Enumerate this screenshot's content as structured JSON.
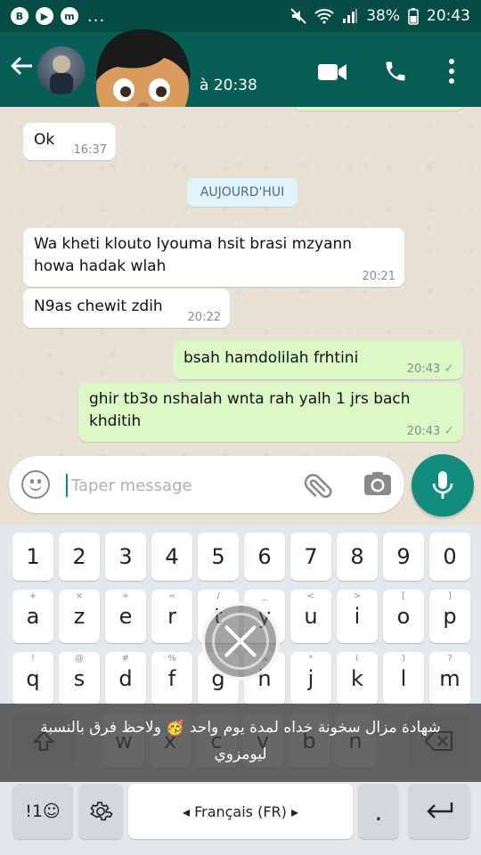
{
  "status_bar": {
    "left_icons": [
      "B",
      "▶",
      "m"
    ],
    "dots": "...",
    "signal_icon": "signal-icon",
    "battery_percent": "38%",
    "time": "20:43"
  },
  "header": {
    "last_seen": "à 20:38"
  },
  "chat": {
    "date_divider": "AUJOURD'HUI",
    "messages": [
      {
        "dir": "in",
        "text": "Ok",
        "time": "16:37"
      },
      {
        "dir": "in",
        "text": "Wa kheti klouto lyouma hsit brasi mzyann howa hadak wlah",
        "time": "20:21"
      },
      {
        "dir": "in",
        "text": "N9as chewit zdih",
        "time": "20:22"
      },
      {
        "dir": "out",
        "text": "bsah  hamdolilah frhtini",
        "time": "20:43"
      },
      {
        "dir": "out",
        "text": "ghir tb3o nshalah wnta rah yalh 1 jrs bach khditih",
        "time": "20:43"
      }
    ]
  },
  "composer": {
    "placeholder": "Taper message"
  },
  "keyboard": {
    "number_row": [
      "1",
      "2",
      "3",
      "4",
      "5",
      "6",
      "7",
      "8",
      "9",
      "0"
    ],
    "row1": [
      {
        "label": "a",
        "hint": "+"
      },
      {
        "label": "z",
        "hint": "×"
      },
      {
        "label": "e",
        "hint": "÷"
      },
      {
        "label": "r",
        "hint": "="
      },
      {
        "label": "t",
        "hint": "/"
      },
      {
        "label": "y",
        "hint": "_"
      },
      {
        "label": "u",
        "hint": "<"
      },
      {
        "label": "i",
        "hint": ">"
      },
      {
        "label": "o",
        "hint": "["
      },
      {
        "label": "p",
        "hint": "]"
      }
    ],
    "row2": [
      {
        "label": "q",
        "hint": "!"
      },
      {
        "label": "s",
        "hint": "@"
      },
      {
        "label": "d",
        "hint": "#"
      },
      {
        "label": "f",
        "hint": "%"
      },
      {
        "label": "g",
        "hint": "^"
      },
      {
        "label": "h",
        "hint": "&"
      },
      {
        "label": "j",
        "hint": "*"
      },
      {
        "label": "k",
        "hint": "("
      },
      {
        "label": "l",
        "hint": ")"
      },
      {
        "label": "m",
        "hint": "?"
      }
    ],
    "row3": [
      "w",
      "x",
      "c",
      "v",
      "b",
      "n"
    ],
    "symbols_key": "!1☺",
    "language": "◂  Français (FR)  ▸",
    "period": ".",
    "shift_icon": "shift-icon",
    "backspace_icon": "backspace-icon",
    "settings_icon": "gear-icon",
    "enter_icon": "enter-icon"
  },
  "caption": {
    "line1": "شهادة مزال  سخونة خداه لمدة يوم واحد 🥳 ولاحظ فرق  بالنسبة",
    "line2": "ليومزوي"
  },
  "colors": {
    "header": "#075e54",
    "status": "#054d44",
    "accent": "#128c7e",
    "outgoing_bubble": "#dcf8c6",
    "incoming_bubble": "#ffffff"
  }
}
